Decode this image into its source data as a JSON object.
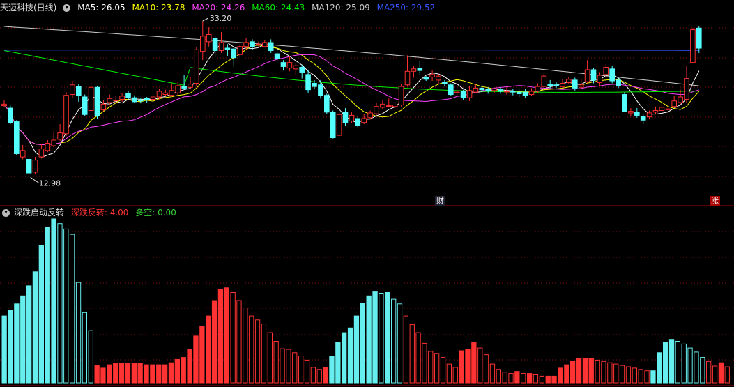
{
  "main_panel": {
    "title": "天迈科技(日线)",
    "ma_labels": [
      {
        "text": "MA5: 26.05",
        "color": "#ffffff"
      },
      {
        "text": "MA10: 23.78",
        "color": "#ffff00"
      },
      {
        "text": "MA20: 24.26",
        "color": "#ff44ff"
      },
      {
        "text": "MA60: 24.43",
        "color": "#00ee00"
      },
      {
        "text": "MA120: 25.09",
        "color": "#cccccc"
      },
      {
        "text": "MA250: 29.52",
        "color": "#3355ff"
      }
    ],
    "high_label": "33.20",
    "low_label": "12.98",
    "event_tag_cai": "财",
    "event_tag_zhang": "涨"
  },
  "indicator_panel": {
    "title": "深跌启动反转",
    "series_label_1": "深跌反转: 4.00",
    "series_label_2": "多空: 0.00",
    "colors": {
      "red": "#ff3333",
      "cyan": "#66eeee",
      "green": "#33cc33"
    }
  },
  "chart_data": [
    {
      "type": "candlestick",
      "title": "天迈科技(日线)",
      "price_range": [
        12.98,
        33.2
      ],
      "candles": [
        [
          22.6,
          22.8,
          23.3,
          22.4
        ],
        [
          22.3,
          20.5,
          22.6,
          20.3
        ],
        [
          20.6,
          16.6,
          20.8,
          16.4
        ],
        [
          16.2,
          17.0,
          17.7,
          15.9
        ],
        [
          15.9,
          14.2,
          16.0,
          14.0
        ],
        [
          14.3,
          15.8,
          16.2,
          14.1
        ],
        [
          16.2,
          17.2,
          17.8,
          16.0
        ],
        [
          17.0,
          17.9,
          18.3,
          16.8
        ],
        [
          17.6,
          18.3,
          19.4,
          17.4
        ],
        [
          18.4,
          19.2,
          20.3,
          18.2
        ],
        [
          19.1,
          23.9,
          24.3,
          18.8
        ],
        [
          24.0,
          25.2,
          25.7,
          23.6
        ],
        [
          25.0,
          23.9,
          25.3,
          23.1
        ],
        [
          23.7,
          21.5,
          24.0,
          21.3
        ],
        [
          22.0,
          24.9,
          25.5,
          21.8
        ],
        [
          24.9,
          21.3,
          25.1,
          21.0
        ],
        [
          22.1,
          22.8,
          23.3,
          21.9
        ],
        [
          23.0,
          23.5,
          24.0,
          22.7
        ],
        [
          23.3,
          23.3,
          23.8,
          23.0
        ],
        [
          23.4,
          23.8,
          24.2,
          23.1
        ],
        [
          24.1,
          23.6,
          24.5,
          23.3
        ],
        [
          23.6,
          23.1,
          23.9,
          22.9
        ],
        [
          23.3,
          23.2,
          23.5,
          22.9
        ],
        [
          23.5,
          23.4,
          23.7,
          23.0
        ],
        [
          23.4,
          23.7,
          24.0,
          23.1
        ],
        [
          23.7,
          24.4,
          24.7,
          23.4
        ],
        [
          24.0,
          24.2,
          24.6,
          23.8
        ],
        [
          23.9,
          24.5,
          25.4,
          23.7
        ],
        [
          24.2,
          25.1,
          25.6,
          23.9
        ],
        [
          25.0,
          24.8,
          26.4,
          24.6
        ],
        [
          24.9,
          25.3,
          26.2,
          24.6
        ],
        [
          25.4,
          29.6,
          29.9,
          25.1
        ],
        [
          29.4,
          31.3,
          33.2,
          28.3
        ],
        [
          30.6,
          31.5,
          32.4,
          30.0
        ],
        [
          31.0,
          29.5,
          31.3,
          28.7
        ],
        [
          29.5,
          30.5,
          31.8,
          29.2
        ],
        [
          29.8,
          29.6,
          30.3,
          28.8
        ],
        [
          29.7,
          28.6,
          29.8,
          27.5
        ],
        [
          29.0,
          30.0,
          30.3,
          28.7
        ],
        [
          30.0,
          30.5,
          31.1,
          29.6
        ],
        [
          30.6,
          30.0,
          30.9,
          29.6
        ],
        [
          30.3,
          30.3,
          30.6,
          30.0
        ],
        [
          30.0,
          30.5,
          30.8,
          29.9
        ],
        [
          30.5,
          29.5,
          30.9,
          29.2
        ],
        [
          29.1,
          28.5,
          29.7,
          28.1
        ],
        [
          28.0,
          27.5,
          28.3,
          27.0
        ],
        [
          27.3,
          28.0,
          28.8,
          26.9
        ],
        [
          27.2,
          27.6,
          27.9,
          26.5
        ],
        [
          27.4,
          26.8,
          27.7,
          26.0
        ],
        [
          26.5,
          24.6,
          27.1,
          24.2
        ],
        [
          25.4,
          25.0,
          25.8,
          24.7
        ],
        [
          25.2,
          23.9,
          25.8,
          23.5
        ],
        [
          23.9,
          21.8,
          24.1,
          21.6
        ],
        [
          21.8,
          18.6,
          22.0,
          18.5
        ],
        [
          18.9,
          21.5,
          21.9,
          18.7
        ],
        [
          21.8,
          20.5,
          22.3,
          20.1
        ],
        [
          20.7,
          21.4,
          21.8,
          20.4
        ],
        [
          21.0,
          20.1,
          21.3,
          19.9
        ],
        [
          20.5,
          21.0,
          21.6,
          20.3
        ],
        [
          21.1,
          21.7,
          22.0,
          20.9
        ],
        [
          21.6,
          22.5,
          23.0,
          21.4
        ],
        [
          22.4,
          22.8,
          23.3,
          22.2
        ],
        [
          22.6,
          22.6,
          23.5,
          22.4
        ],
        [
          22.5,
          22.7,
          23.0,
          22.3
        ],
        [
          22.7,
          25.0,
          25.3,
          22.5
        ],
        [
          25.2,
          26.9,
          28.9,
          25.0
        ],
        [
          26.9,
          27.2,
          27.6,
          26.1
        ],
        [
          27.3,
          27.0,
          28.2,
          26.5
        ],
        [
          26.1,
          25.9,
          26.3,
          25.7
        ],
        [
          26.2,
          26.5,
          27.0,
          25.7
        ],
        [
          25.8,
          26.3,
          26.6,
          25.3
        ],
        [
          25.5,
          25.4,
          25.8,
          25.0
        ],
        [
          25.2,
          24.0,
          25.4,
          23.8
        ],
        [
          24.2,
          24.3,
          24.6,
          23.9
        ],
        [
          24.4,
          23.6,
          24.6,
          23.3
        ],
        [
          23.6,
          24.5,
          25.1,
          23.2
        ],
        [
          24.3,
          24.8,
          25.3,
          24.2
        ],
        [
          24.8,
          24.6,
          25.2,
          24.3
        ],
        [
          24.7,
          24.5,
          24.9,
          24.1
        ],
        [
          24.5,
          24.7,
          24.9,
          24.2
        ],
        [
          24.6,
          24.4,
          24.9,
          24.1
        ],
        [
          24.4,
          24.4,
          24.9,
          24.0
        ],
        [
          24.4,
          24.3,
          24.7,
          23.9
        ],
        [
          24.3,
          24.1,
          24.6,
          23.7
        ],
        [
          24.3,
          23.9,
          24.7,
          23.6
        ],
        [
          24.0,
          24.4,
          24.8,
          23.8
        ],
        [
          24.4,
          25.0,
          25.4,
          24.2
        ],
        [
          25.0,
          26.3,
          26.6,
          24.8
        ],
        [
          25.3,
          25.1,
          25.8,
          24.8
        ],
        [
          25.2,
          25.1,
          25.5,
          24.8
        ],
        [
          25.0,
          25.4,
          25.9,
          24.8
        ],
        [
          25.5,
          25.9,
          26.2,
          25.3
        ],
        [
          25.8,
          24.8,
          26.1,
          24.5
        ],
        [
          24.9,
          25.2,
          26.0,
          24.6
        ],
        [
          25.6,
          27.1,
          28.3,
          25.4
        ],
        [
          27.1,
          25.8,
          27.3,
          25.4
        ],
        [
          25.5,
          26.4,
          26.8,
          25.1
        ],
        [
          26.5,
          27.4,
          27.8,
          26.2
        ],
        [
          27.2,
          25.7,
          27.6,
          25.4
        ],
        [
          25.8,
          25.1,
          26.1,
          24.8
        ],
        [
          24.0,
          21.9,
          24.3,
          21.8
        ],
        [
          21.7,
          21.9,
          22.3,
          21.3
        ],
        [
          21.8,
          21.4,
          22.3,
          21.1
        ],
        [
          21.3,
          20.8,
          21.6,
          20.3
        ],
        [
          21.2,
          21.7,
          22.0,
          20.9
        ],
        [
          21.8,
          22.0,
          22.5,
          21.6
        ],
        [
          22.0,
          22.4,
          22.6,
          21.8
        ],
        [
          22.2,
          22.2,
          22.7,
          21.9
        ],
        [
          22.5,
          23.2,
          23.8,
          22.3
        ],
        [
          23.0,
          23.7,
          24.6,
          22.8
        ],
        [
          23.4,
          26.0,
          27.6,
          23.0
        ],
        [
          28.0,
          32.1,
          32.3,
          27.9
        ],
        [
          32.3,
          29.8,
          32.5,
          29.2
        ]
      ]
    },
    {
      "type": "bar",
      "title": "深跌启动反转",
      "series": [
        {
          "name": "深跌反转",
          "values": [
            4
          ]
        },
        {
          "name": "多空",
          "values": [
            0
          ]
        }
      ],
      "bar_style": [
        "cf",
        "cf",
        "cf",
        "cf",
        "cf",
        "cf",
        "cf",
        "cf",
        "co",
        "co",
        "co",
        "co",
        "co",
        "co",
        "co",
        "cf",
        "co",
        "co",
        "co",
        "co",
        "co",
        "co",
        "co",
        "co",
        "co",
        "co",
        "co",
        "co",
        "co",
        "co",
        "co",
        "co",
        "co",
        "co",
        "co",
        "co",
        "co",
        "co",
        "co",
        "co",
        "co",
        "co",
        "co",
        "co",
        "co",
        "co",
        "co",
        "co",
        "co",
        "co",
        "co",
        "co",
        "co",
        "co",
        "co",
        "co",
        "co",
        "co",
        "co",
        "co",
        "co",
        "co",
        "co",
        "co",
        "co",
        "co",
        "co",
        "co",
        "co",
        "co",
        "co",
        "co",
        "co",
        "co",
        "co",
        "co",
        "co",
        "co",
        "co",
        "co",
        "co",
        "co",
        "co",
        "co",
        "co",
        "co",
        "co",
        "co",
        "co",
        "co",
        "co",
        "co",
        "co",
        "co",
        "co",
        "co",
        "co",
        "co",
        "co",
        "co",
        "co",
        "co",
        "co",
        "co",
        "co",
        "co",
        "co",
        "co",
        "co",
        "co",
        "co",
        "co",
        "co"
      ],
      "values": [
        100,
        108,
        118,
        130,
        145,
        166,
        205,
        232,
        245,
        238,
        230,
        222,
        150,
        105,
        78,
        26,
        22,
        27,
        29,
        29,
        29,
        29,
        29,
        27,
        27,
        27,
        27,
        30,
        35,
        38,
        50,
        70,
        85,
        100,
        123,
        140,
        142,
        135,
        123,
        112,
        100,
        94,
        88,
        75,
        62,
        51,
        50,
        45,
        40,
        34,
        23,
        20,
        23,
        40,
        60,
        75,
        82,
        100,
        119,
        130,
        136,
        134,
        135,
        125,
        118,
        100,
        87,
        75,
        59,
        47,
        44,
        38,
        28,
        23,
        48,
        50,
        60,
        52,
        42,
        28,
        20,
        16,
        14,
        17,
        14,
        14,
        12,
        10,
        10,
        10,
        22,
        27,
        32,
        36,
        36,
        36,
        34,
        32,
        30,
        28,
        26,
        24,
        22,
        20,
        18,
        18,
        45,
        60,
        65,
        62,
        58,
        52,
        46,
        38,
        32,
        25,
        30,
        24
      ]
    }
  ]
}
